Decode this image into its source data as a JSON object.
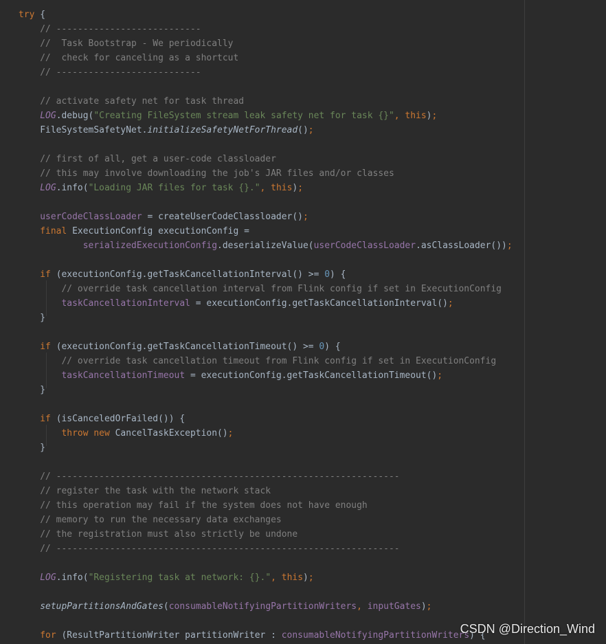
{
  "editor": {
    "colors": {
      "background": "#2b2b2b",
      "default": "#a9b7c6",
      "keyword": "#cc7832",
      "comment": "#808080",
      "string": "#6a8759",
      "field": "#9876aa",
      "number": "#6897bb"
    },
    "lines": [
      [
        [
          "kw",
          "try"
        ],
        [
          "p",
          " {"
        ]
      ],
      [
        [
          "p",
          "    "
        ],
        [
          "com",
          "// ---------------------------"
        ]
      ],
      [
        [
          "p",
          "    "
        ],
        [
          "com",
          "//  Task Bootstrap - We periodically"
        ]
      ],
      [
        [
          "p",
          "    "
        ],
        [
          "com",
          "//  check for canceling as a shortcut"
        ]
      ],
      [
        [
          "p",
          "    "
        ],
        [
          "com",
          "// ---------------------------"
        ]
      ],
      [],
      [
        [
          "p",
          "    "
        ],
        [
          "com",
          "// activate safety net for task thread"
        ]
      ],
      [
        [
          "p",
          "    "
        ],
        [
          "fi",
          "LOG"
        ],
        [
          "p",
          ".debug("
        ],
        [
          "str",
          "\"Creating FileSystem stream leak safety net for task {}\""
        ],
        [
          "kw",
          ", this"
        ],
        [
          "p",
          ")"
        ],
        [
          "kw",
          ";"
        ]
      ],
      [
        [
          "p",
          "    FileSystemSafetyNet."
        ],
        [
          "it",
          "initializeSafetyNetForThread"
        ],
        [
          "p",
          "()"
        ],
        [
          "kw",
          ";"
        ]
      ],
      [],
      [
        [
          "p",
          "    "
        ],
        [
          "com",
          "// first of all, get a user-code classloader"
        ]
      ],
      [
        [
          "p",
          "    "
        ],
        [
          "com",
          "// this may involve downloading the job's JAR files and/or classes"
        ]
      ],
      [
        [
          "p",
          "    "
        ],
        [
          "fi",
          "LOG"
        ],
        [
          "p",
          ".info("
        ],
        [
          "str",
          "\"Loading JAR files for task {}.\""
        ],
        [
          "kw",
          ", this"
        ],
        [
          "p",
          ")"
        ],
        [
          "kw",
          ";"
        ]
      ],
      [],
      [
        [
          "p",
          "    "
        ],
        [
          "field",
          "userCodeClassLoader"
        ],
        [
          "p",
          " = createUserCodeClassloader()"
        ],
        [
          "kw",
          ";"
        ]
      ],
      [
        [
          "p",
          "    "
        ],
        [
          "kw",
          "final "
        ],
        [
          "p",
          "ExecutionConfig executionConfig ="
        ]
      ],
      [
        [
          "p",
          "            "
        ],
        [
          "field",
          "serializedExecutionConfig"
        ],
        [
          "p",
          ".deserializeValue("
        ],
        [
          "field",
          "userCodeClassLoader"
        ],
        [
          "p",
          ".asClassLoader())"
        ],
        [
          "kw",
          ";"
        ]
      ],
      [],
      [
        [
          "p",
          "    "
        ],
        [
          "kw",
          "if "
        ],
        [
          "p",
          "(executionConfig.getTaskCancellationInterval() >= "
        ],
        [
          "num",
          "0"
        ],
        [
          "p",
          ") {"
        ]
      ],
      [
        [
          "p",
          "        "
        ],
        [
          "com",
          "// override task cancellation interval from Flink config if set in ExecutionConfig"
        ]
      ],
      [
        [
          "p",
          "        "
        ],
        [
          "field",
          "taskCancellationInterval"
        ],
        [
          "p",
          " = executionConfig.getTaskCancellationInterval()"
        ],
        [
          "kw",
          ";"
        ]
      ],
      [
        [
          "p",
          "    }"
        ]
      ],
      [],
      [
        [
          "p",
          "    "
        ],
        [
          "kw",
          "if "
        ],
        [
          "p",
          "(executionConfig.getTaskCancellationTimeout() >= "
        ],
        [
          "num",
          "0"
        ],
        [
          "p",
          ") {"
        ]
      ],
      [
        [
          "p",
          "        "
        ],
        [
          "com",
          "// override task cancellation timeout from Flink config if set in ExecutionConfig"
        ]
      ],
      [
        [
          "p",
          "        "
        ],
        [
          "field",
          "taskCancellationTimeout"
        ],
        [
          "p",
          " = executionConfig.getTaskCancellationTimeout()"
        ],
        [
          "kw",
          ";"
        ]
      ],
      [
        [
          "p",
          "    }"
        ]
      ],
      [],
      [
        [
          "p",
          "    "
        ],
        [
          "kw",
          "if "
        ],
        [
          "p",
          "(isCanceledOrFailed()) {"
        ]
      ],
      [
        [
          "p",
          "        "
        ],
        [
          "kw",
          "throw new "
        ],
        [
          "p",
          "CancelTaskException()"
        ],
        [
          "kw",
          ";"
        ]
      ],
      [
        [
          "p",
          "    }"
        ]
      ],
      [],
      [
        [
          "p",
          "    "
        ],
        [
          "com",
          "// ----------------------------------------------------------------"
        ]
      ],
      [
        [
          "p",
          "    "
        ],
        [
          "com",
          "// register the task with the network stack"
        ]
      ],
      [
        [
          "p",
          "    "
        ],
        [
          "com",
          "// this operation may fail if the system does not have enough"
        ]
      ],
      [
        [
          "p",
          "    "
        ],
        [
          "com",
          "// memory to run the necessary data exchanges"
        ]
      ],
      [
        [
          "p",
          "    "
        ],
        [
          "com",
          "// the registration must also strictly be undone"
        ]
      ],
      [
        [
          "p",
          "    "
        ],
        [
          "com",
          "// ----------------------------------------------------------------"
        ]
      ],
      [],
      [
        [
          "p",
          "    "
        ],
        [
          "fi",
          "LOG"
        ],
        [
          "p",
          ".info("
        ],
        [
          "str",
          "\"Registering task at network: {}.\""
        ],
        [
          "kw",
          ", this"
        ],
        [
          "p",
          ")"
        ],
        [
          "kw",
          ";"
        ]
      ],
      [],
      [
        [
          "p",
          "    "
        ],
        [
          "it",
          "setupPartitionsAndGates"
        ],
        [
          "p",
          "("
        ],
        [
          "field",
          "consumableNotifyingPartitionWriters"
        ],
        [
          "kw",
          ", "
        ],
        [
          "field",
          "inputGates"
        ],
        [
          "p",
          ")"
        ],
        [
          "kw",
          ";"
        ]
      ],
      [],
      [
        [
          "p",
          "    "
        ],
        [
          "kw",
          "for "
        ],
        [
          "p",
          "(ResultPartitionWriter partitionWriter : "
        ],
        [
          "field",
          "consumableNotifyingPartitionWriters"
        ],
        [
          "p",
          ") {"
        ]
      ]
    ]
  },
  "watermark": "CSDN @Direction_Wind"
}
